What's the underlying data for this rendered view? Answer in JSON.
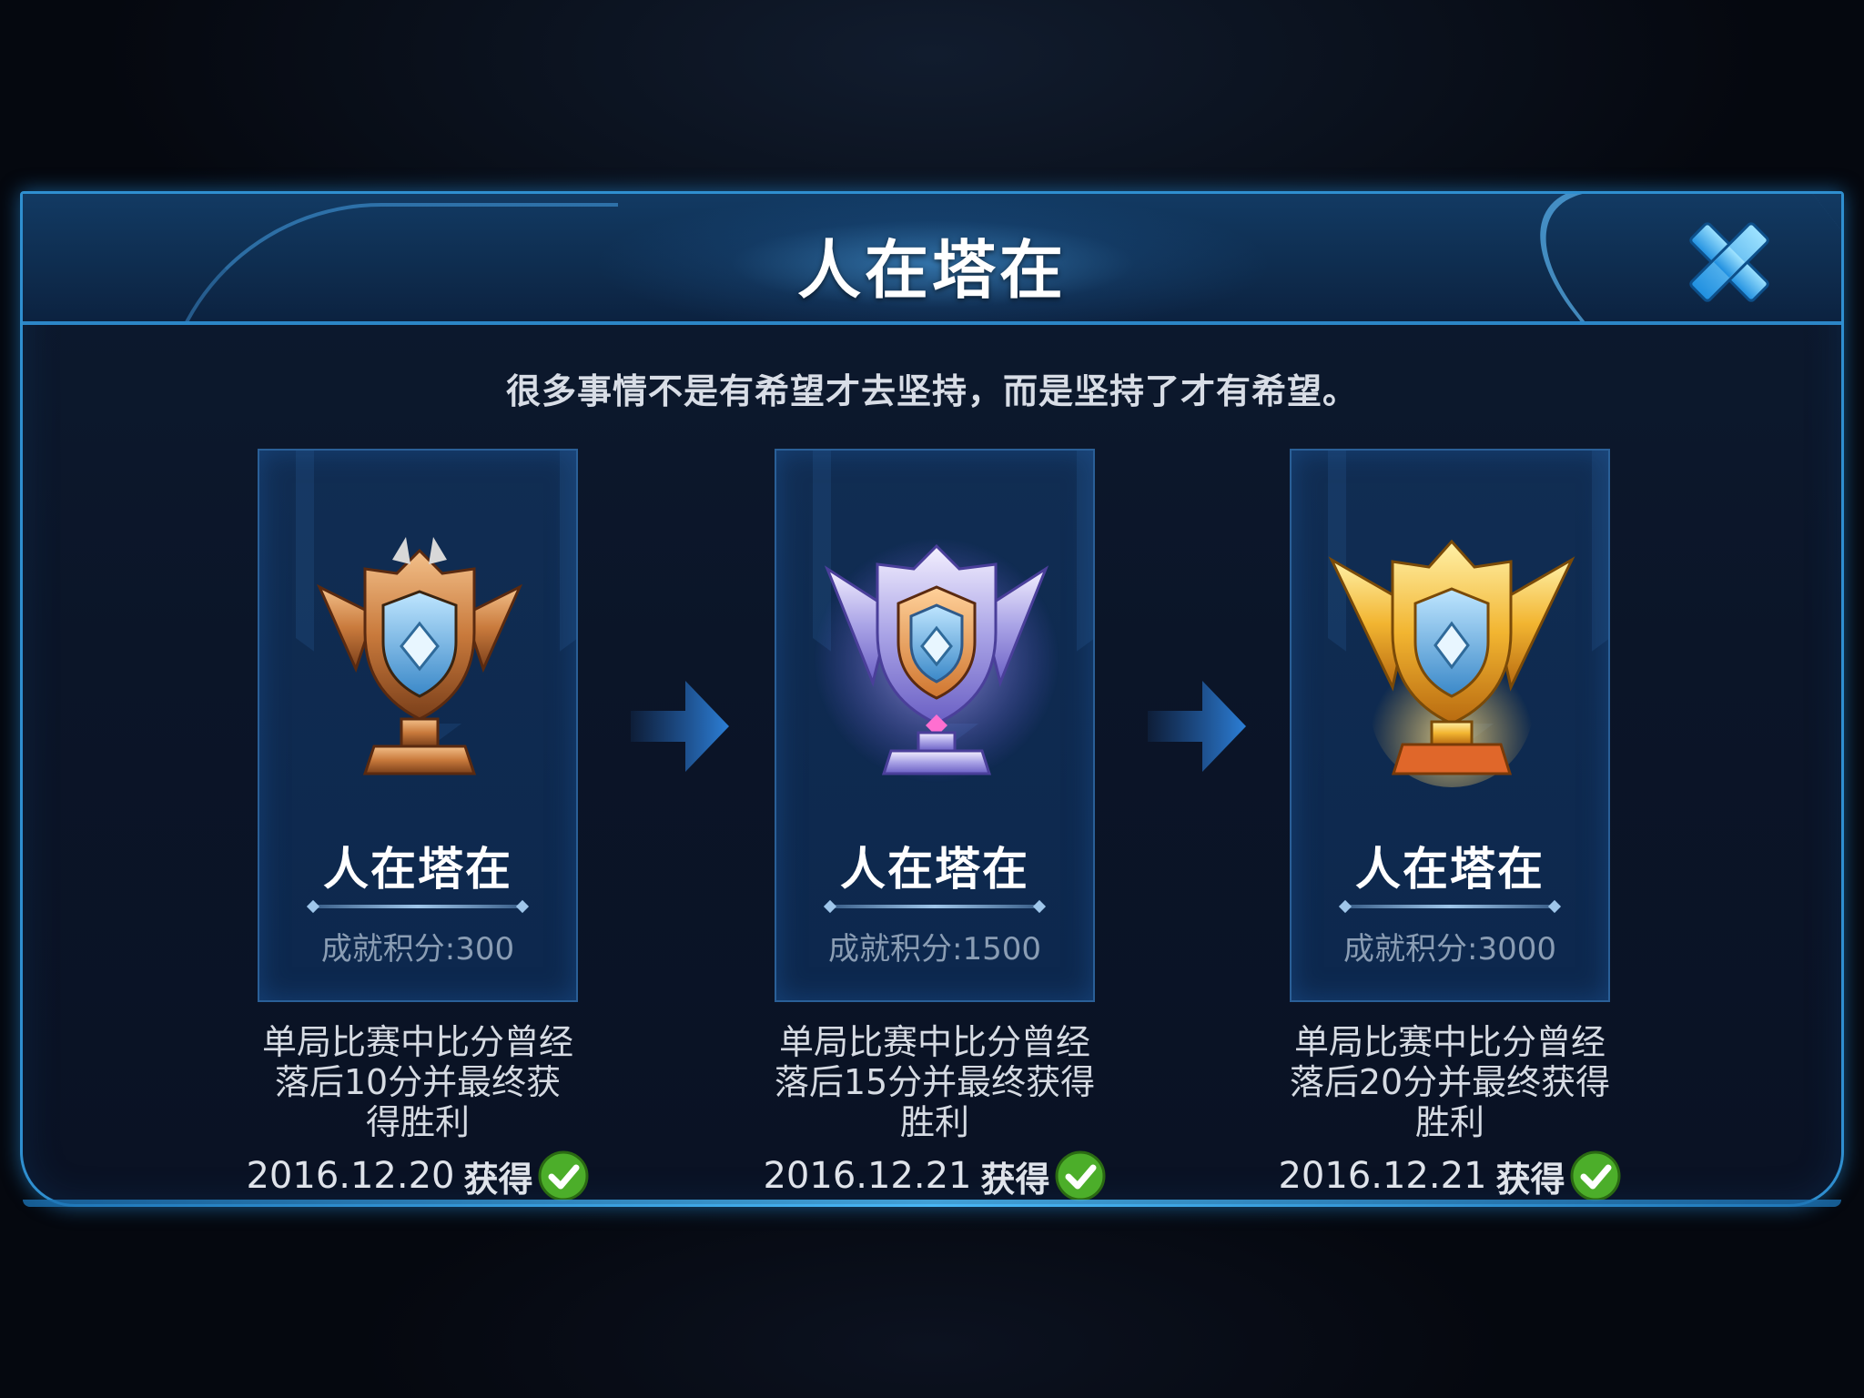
{
  "dialog": {
    "title": "人在塔在",
    "subtitle": "很多事情不是有希望才去坚持，而是坚持了才有希望。",
    "close_icon": "close-x-icon"
  },
  "colors": {
    "accent": "#2f8fd0",
    "panel": "#0b1528",
    "card": "#15406f",
    "check_green": "#4cae2a"
  },
  "tiers": [
    {
      "tier": "bronze",
      "icon": "bronze-trophy-icon",
      "name": "人在塔在",
      "points": "成就积分:300",
      "desc_line1": "单局比赛中比分曾经",
      "desc_line2": "落后10分并最终获",
      "desc_line3": "得胜利",
      "date": "2016.12.20",
      "obtained": "获得",
      "status_icon": "check-icon"
    },
    {
      "tier": "silver",
      "icon": "silver-trophy-icon",
      "name": "人在塔在",
      "points": "成就积分:1500",
      "desc_line1": "单局比赛中比分曾经",
      "desc_line2": "落后15分并最终获得",
      "desc_line3": "胜利",
      "date": "2016.12.21",
      "obtained": "获得",
      "status_icon": "check-icon"
    },
    {
      "tier": "gold",
      "icon": "gold-trophy-icon",
      "name": "人在塔在",
      "points": "成就积分:3000",
      "desc_line1": "单局比赛中比分曾经",
      "desc_line2": "落后20分并最终获得",
      "desc_line3": "胜利",
      "date": "2016.12.21",
      "obtained": "获得",
      "status_icon": "check-icon"
    }
  ]
}
